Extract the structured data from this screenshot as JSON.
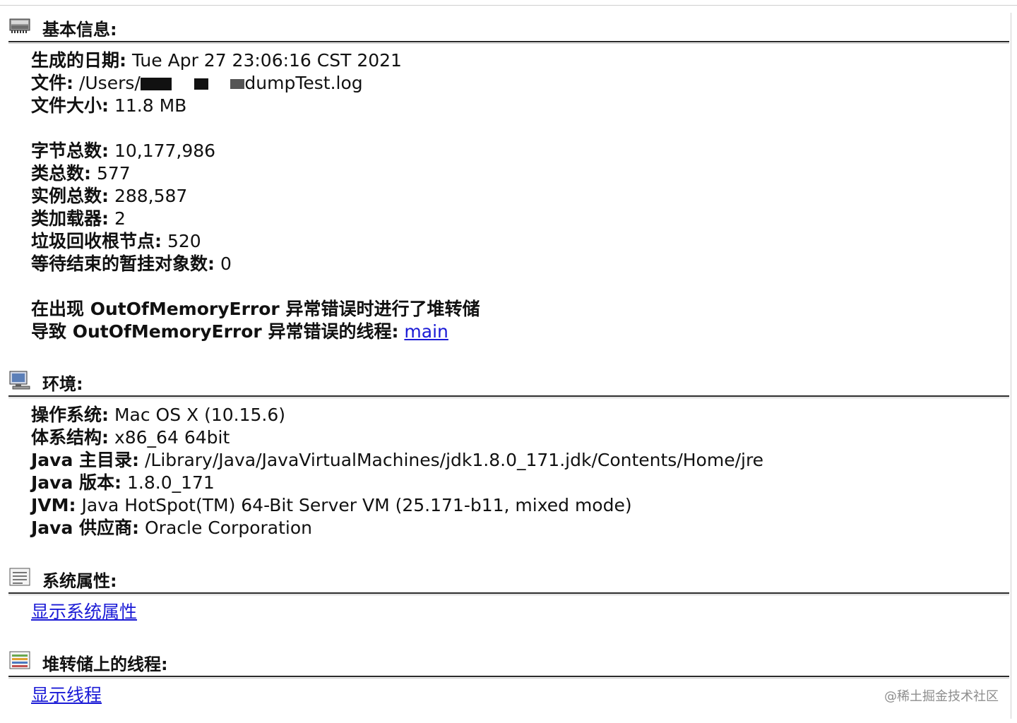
{
  "basic": {
    "title": "基本信息:",
    "date_label": "生成的日期:",
    "date_value": "Tue Apr 27 23:06:16 CST 2021",
    "file_label": "文件:",
    "file_value_prefix": "/Users/",
    "file_value_suffix": "dumpTest.log",
    "size_label": "文件大小:",
    "size_value": "11.8 MB",
    "bytes_label": "字节总数:",
    "bytes_value": "10,177,986",
    "classes_label": "类总数:",
    "classes_value": "577",
    "instances_label": "实例总数:",
    "instances_value": "288,587",
    "classloaders_label": "类加载器:",
    "classloaders_value": "2",
    "gcroots_label": "垃圾回收根节点:",
    "gcroots_value": "520",
    "finalize_label": "等待结束的暂挂对象数:",
    "finalize_value": "0",
    "oom_line": "在出现 OutOfMemoryError 异常错误时进行了堆转储",
    "oom_thread_label": "导致 OutOfMemoryError 异常错误的线程:",
    "oom_thread_link": "main"
  },
  "env": {
    "title": "环境:",
    "os_label": "操作系统:",
    "os_value": "Mac OS X (10.15.6)",
    "arch_label": "体系结构:",
    "arch_value": "x86_64 64bit",
    "javahome_label": "Java 主目录:",
    "javahome_value": "/Library/Java/JavaVirtualMachines/jdk1.8.0_171.jdk/Contents/Home/jre",
    "javaver_label": "Java 版本:",
    "javaver_value": "1.8.0_171",
    "jvm_label": "JVM:",
    "jvm_value": "Java HotSpot(TM) 64-Bit Server VM (25.171-b11, mixed mode)",
    "vendor_label": "Java 供应商:",
    "vendor_value": "Oracle Corporation"
  },
  "sysprops": {
    "title": "系统属性:",
    "link": "显示系统属性"
  },
  "threads": {
    "title": "堆转储上的线程:",
    "link": "显示线程"
  },
  "watermark": "@稀土掘金技术社区",
  "icons": {
    "basic": "memory-chip-icon",
    "env": "computer-monitor-icon",
    "sysprops": "properties-list-icon",
    "threads": "threads-list-icon"
  },
  "colors": {
    "link": "#1a1ad6",
    "rule": "#2a2a2a"
  }
}
